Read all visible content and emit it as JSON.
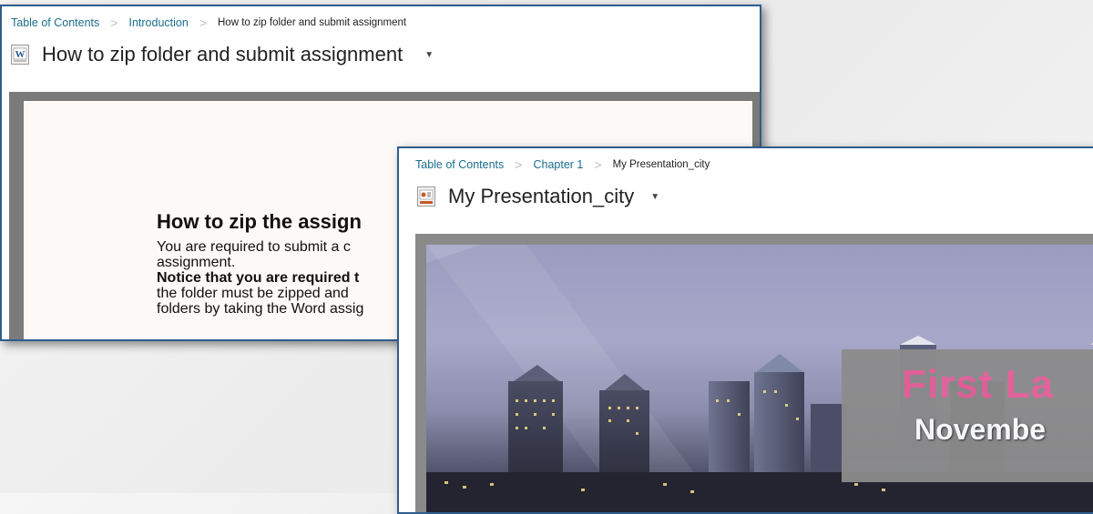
{
  "panel_word": {
    "breadcrumb": {
      "root": "Table of Contents",
      "section": "Introduction",
      "current": "How to zip folder and submit assignment"
    },
    "title": "How to zip folder and submit assignment",
    "file_icon": "word-document-icon",
    "caret": "▼",
    "document": {
      "heading": "How to zip the assign",
      "line1": "You are required to submit a c",
      "line2": "assignment.",
      "line3_bold": "Notice that you are required t",
      "line4": "the folder must be zipped and",
      "line5": "folders by taking the Word assig"
    }
  },
  "panel_ppt": {
    "breadcrumb": {
      "root": "Table of Contents",
      "section": "Chapter 1",
      "current": "My Presentation_city"
    },
    "title": "My Presentation_city",
    "file_icon": "powerpoint-presentation-icon",
    "caret": "▼",
    "slide": {
      "title": "First La",
      "subtitle": "Novembe"
    }
  },
  "colors": {
    "panel_border": "#2f5d8c",
    "link": "#1a6e8e",
    "slide_title": "#e8609b"
  }
}
